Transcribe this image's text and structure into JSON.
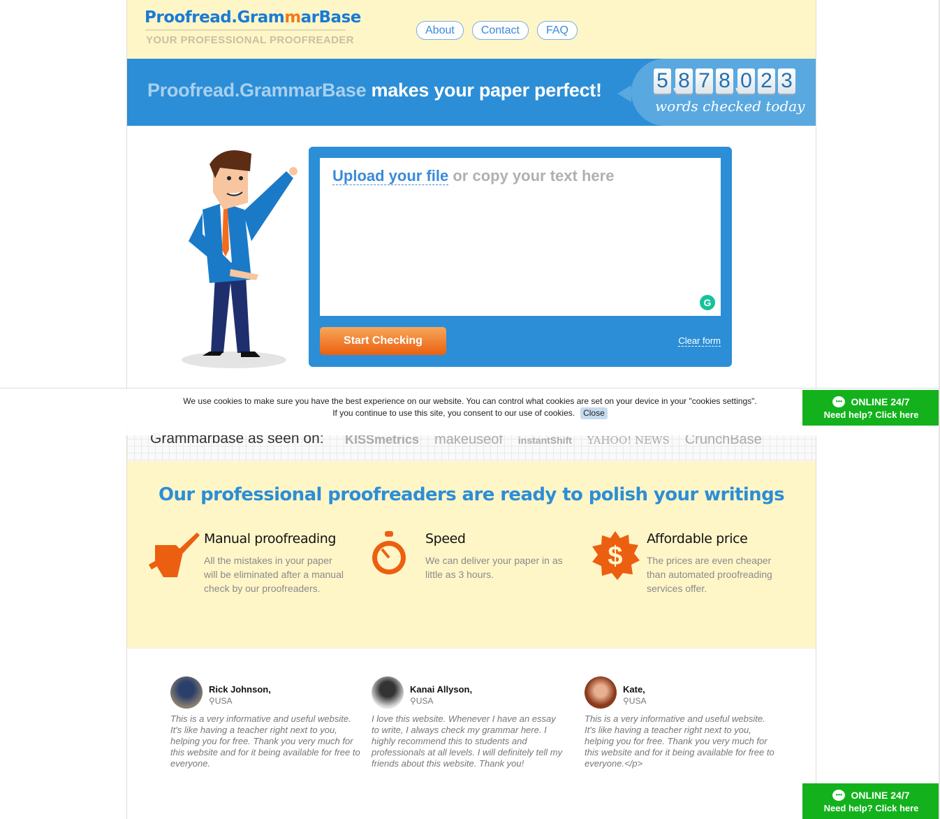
{
  "header": {
    "logo_part1": "Proofread.Gram",
    "logo_m": "m",
    "logo_part2": "arBase",
    "tagline": "YOUR PROFESSIONAL PROOFREADER",
    "nav": [
      {
        "label": "About"
      },
      {
        "label": "Contact"
      },
      {
        "label": "FAQ"
      }
    ]
  },
  "banner": {
    "brand": "Proofread.GrammarBase",
    "headline": " makes your paper perfect!",
    "counter_digits": [
      "5",
      "8",
      "7",
      "8",
      "0",
      "2",
      "3"
    ],
    "counter_value": "5,878,023",
    "counter_caption": "words checked today"
  },
  "editor": {
    "upload_link": "Upload your file",
    "placeholder_rest": " or copy your text here",
    "start_button": "Start Checking",
    "clear_link": "Clear form",
    "grammarly_icon": "G"
  },
  "seen_on": {
    "label": "Grammarbase as seen on:",
    "logos": [
      "KISSmetrics",
      "makeuseof",
      "instantShift",
      "YAHOO! NEWS",
      "CrunchBase"
    ]
  },
  "features": {
    "title": "Our professional proofreaders are ready to polish your writings",
    "items": [
      {
        "title": "Manual proofreading",
        "text": "All the mistakes in your paper will be eliminated after a manual check by our proofreaders.",
        "icon": "fist-pen-icon"
      },
      {
        "title": "Speed",
        "text": "We can deliver your paper in as little as 3 hours.",
        "icon": "stopwatch-icon"
      },
      {
        "title": "Affordable price",
        "text": "The prices are even cheaper than automated proofreading services offer.",
        "icon": "dollar-badge-icon"
      }
    ]
  },
  "testimonials": [
    {
      "name": "Rick Johnson,",
      "location": "USA",
      "quote": "This is a very informative and useful website. It's like having a teacher right next to you, helping you for free. Thank you very much for this website and for it being available for free to everyone."
    },
    {
      "name": "Kanai Allyson,",
      "location": "USA",
      "quote": "I love this website. Whenever I have an essay to write, I always check my grammar here. I highly recommend this to students and professionals at all levels. I will definitely tell my friends about this website. Thank you!"
    },
    {
      "name": "Kate,",
      "location": "USA",
      "quote": "This is a very informative and useful website. It's like having a teacher right next to you, helping you for free. Thank you very much for this website and for it being available for free to everyone.</p>"
    }
  ],
  "cookie": {
    "line1": "We use cookies to make sure you have the best experience on our website. You can control what cookies are set on your device in your \"cookies settings\".",
    "line2": "If you continue to use this site, you consent to our use of cookies.",
    "close": "Close"
  },
  "chat": {
    "status": "ONLINE 24/7",
    "help": "Need help? Click here"
  },
  "colors": {
    "brand_blue": "#2c8ed6",
    "accent_orange": "#ec5f10",
    "header_yellow": "#fff6c8",
    "chat_green": "#13b21c"
  }
}
